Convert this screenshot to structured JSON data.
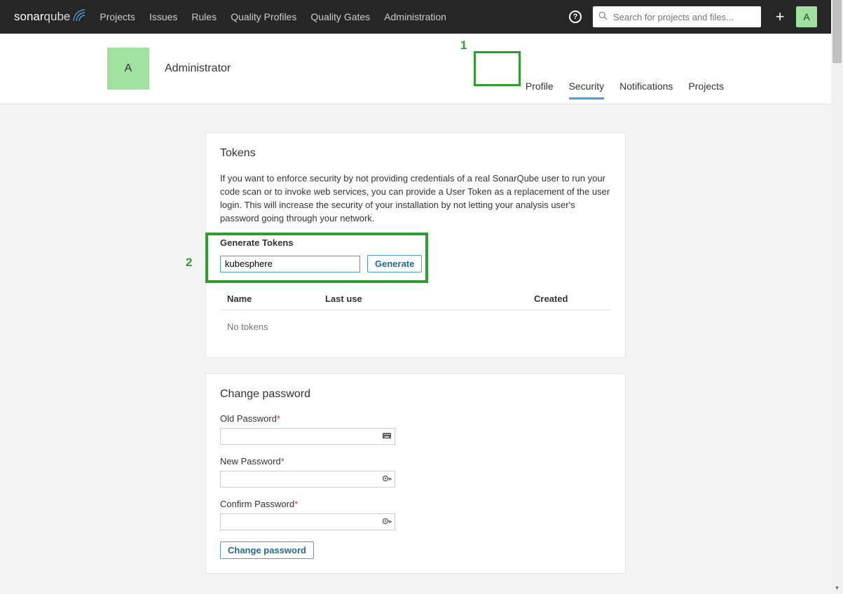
{
  "brand": {
    "name_a": "sonar",
    "name_b": "qube"
  },
  "topnav": {
    "items": [
      "Projects",
      "Issues",
      "Rules",
      "Quality Profiles",
      "Quality Gates",
      "Administration"
    ],
    "search_placeholder": "Search for projects and files...",
    "avatar_initial": "A"
  },
  "account": {
    "avatar_initial": "A",
    "name": "Administrator",
    "tabs": [
      "Profile",
      "Security",
      "Notifications",
      "Projects"
    ],
    "active_tab": "Security"
  },
  "annotations": {
    "one": "1",
    "two": "2"
  },
  "tokens": {
    "heading": "Tokens",
    "description": "If you want to enforce security by not providing credentials of a real SonarQube user to run your code scan or to invoke web services, you can provide a User Token as a replacement of the user login. This will increase the security of your installation by not letting your analysis user's password going through your network.",
    "generate_heading": "Generate Tokens",
    "generate_input_value": "kubesphere",
    "generate_button": "Generate",
    "columns": {
      "name": "Name",
      "last": "Last use",
      "created": "Created"
    },
    "empty": "No tokens"
  },
  "password": {
    "heading": "Change password",
    "old_label": "Old Password",
    "new_label": "New Password",
    "confirm_label": "Confirm Password",
    "required_mark": "*",
    "submit": "Change password"
  }
}
